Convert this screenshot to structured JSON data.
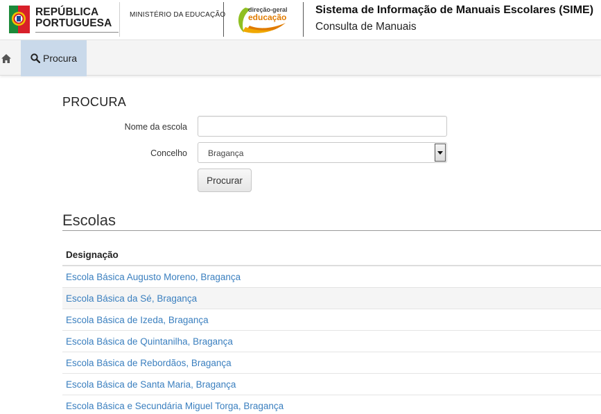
{
  "header": {
    "republic_line1": "REPÚBLICA",
    "republic_line2": "PORTUGUESA",
    "ministry": "MINISTÉRIO DA EDUCAÇÃO",
    "dge_line1": "direção-geral",
    "dge_line2": "educação",
    "system_title": "Sistema de Informação de Manuais Escolares (SIME)",
    "system_subtitle": "Consulta de Manuais"
  },
  "nav": {
    "home_icon": "home-icon",
    "procura_icon": "search-icon",
    "procura_label": "Procura",
    "active_color": "#c9d9ea"
  },
  "form": {
    "section_title": "PROCURA",
    "nome_label": "Nome da escola",
    "nome_value": "",
    "concelho_label": "Concelho",
    "concelho_value": "Bragança",
    "submit_label": "Procurar"
  },
  "escolas": {
    "title": "Escolas",
    "column_header": "Designação",
    "link_color": "#3a7fbf",
    "rows": [
      "Escola Básica Augusto Moreno, Bragança",
      "Escola Básica da Sé, Bragança",
      "Escola Básica de Izeda, Bragança",
      "Escola Básica de Quintanilha, Bragança",
      "Escola Básica de Rebordãos, Bragança",
      "Escola Básica de Santa Maria, Bragança",
      "Escola Básica e Secundária Miguel Torga, Bragança"
    ]
  }
}
